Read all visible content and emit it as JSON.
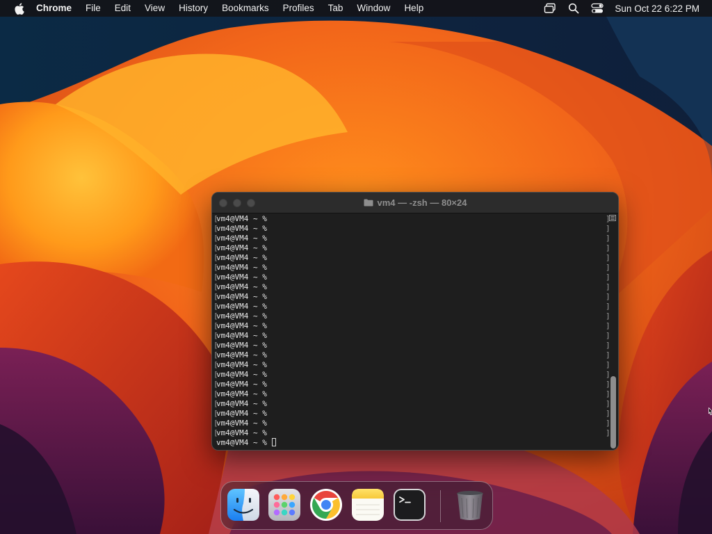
{
  "menubar": {
    "apple_icon": "apple-logo-icon",
    "app_name": "Chrome",
    "items": [
      "File",
      "Edit",
      "View",
      "History",
      "Bookmarks",
      "Profiles",
      "Tab",
      "Window",
      "Help"
    ],
    "status_icons": [
      "screen-mirroring-icon",
      "spotlight-search-icon",
      "control-center-icon"
    ],
    "clock": "Sun Oct 22  6:22 PM"
  },
  "terminal": {
    "title": "vm4 — -zsh — 80×24",
    "title_icon": "folder-icon",
    "prompt": "vm4@VM4 ~ %",
    "lines": [
      "[vm4@VM4 ~ %",
      "[vm4@VM4 ~ %",
      "[vm4@VM4 ~ %",
      "[vm4@VM4 ~ %",
      "[vm4@VM4 ~ %",
      "[vm4@VM4 ~ %",
      "[vm4@VM4 ~ %",
      "[vm4@VM4 ~ %",
      "[vm4@VM4 ~ %",
      "[vm4@VM4 ~ %",
      "[vm4@VM4 ~ %",
      "[vm4@VM4 ~ %",
      "[vm4@VM4 ~ %",
      "[vm4@VM4 ~ %",
      "[vm4@VM4 ~ %",
      "[vm4@VM4 ~ %",
      "[vm4@VM4 ~ %",
      "[vm4@VM4 ~ %",
      "[vm4@VM4 ~ %",
      "[vm4@VM4 ~ %",
      "[vm4@VM4 ~ %",
      "[vm4@VM4 ~ %",
      "[vm4@VM4 ~ %"
    ],
    "current_line": "vm4@VM4 ~ % "
  },
  "dock": {
    "apps": [
      "finder-icon",
      "launchpad-icon",
      "chrome-icon",
      "notes-icon",
      "terminal-icon"
    ],
    "trash": "trash-icon"
  },
  "colors": {
    "menubar_bg": "#141418",
    "terminal_bg": "#1e1e1e",
    "wallpaper_orange": "#f07a1a",
    "wallpaper_navy": "#10243f"
  }
}
